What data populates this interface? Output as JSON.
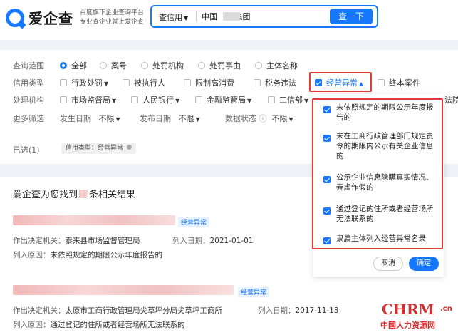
{
  "header": {
    "logo_text": "爱企查",
    "slogan_line1": "百度旗下企业查询平台",
    "slogan_line2": "专业查企业就上爱企查",
    "search_type": "查信用",
    "search_value": "中国       集团",
    "search_button": "查一下"
  },
  "filters": {
    "scope": {
      "label": "查询范围",
      "options": [
        "全部",
        "案号",
        "处罚机构",
        "处罚事由",
        "主体名称"
      ],
      "selected": "全部"
    },
    "credit_type": {
      "label": "信用类型",
      "options": [
        "行政处罚",
        "被执行人",
        "限制高消费",
        "税务违法",
        "经营异常",
        "终本案件"
      ],
      "active": "经营异常"
    },
    "authority": {
      "label": "处理机构",
      "options": [
        "市场监督局",
        "人民银行",
        "金融监管局",
        "工信部",
        "法院"
      ]
    },
    "more": {
      "label": "更多筛选",
      "items": [
        "发生日期",
        "发布日期",
        "数据状态"
      ],
      "value": "不限"
    },
    "selected": {
      "label": "已选(1)",
      "tag": "信用类型：经营异常"
    }
  },
  "dropdown": {
    "items": [
      "未依照规定的期限公示年度报告的",
      "未在工商行政管理部门规定责令的期限内公示有关企业信息的",
      "公示企业信息隐瞒真实情况、弄虚作假的",
      "通过登记的住所或者经营场所无法联系的",
      "隶属主体列入经营异常名录"
    ],
    "cancel": "取消",
    "confirm": "确定"
  },
  "results": {
    "title_prefix": "爱企查为您找到",
    "title_suffix": "条相关结果",
    "items": [
      {
        "badge": "经营异常",
        "authority_label": "作出决定机关：",
        "authority": "泰来县市场监督管理局",
        "date_label": "列入日期：",
        "date": "2021-01-01",
        "reason_label": "列入原因：",
        "reason": "未依照规定的期限公示年度报告的"
      },
      {
        "badge": "经营异常",
        "authority_label": "作出决定机关：",
        "authority": "太原市工商行政管理局尖草坪分局尖草坪工商所",
        "date_label": "列入日期：",
        "date": "2017-11-13",
        "reason_label": "列入原因：",
        "reason": "通过登记的住所或者经营场所无法联系的"
      }
    ]
  },
  "watermark": {
    "brand": "CHRM",
    "domain": ".cn",
    "name": "中国人力资源网"
  },
  "colors": {
    "accent": "#1677ff",
    "highlight": "#e53935",
    "watermark": "#d32f2f"
  }
}
